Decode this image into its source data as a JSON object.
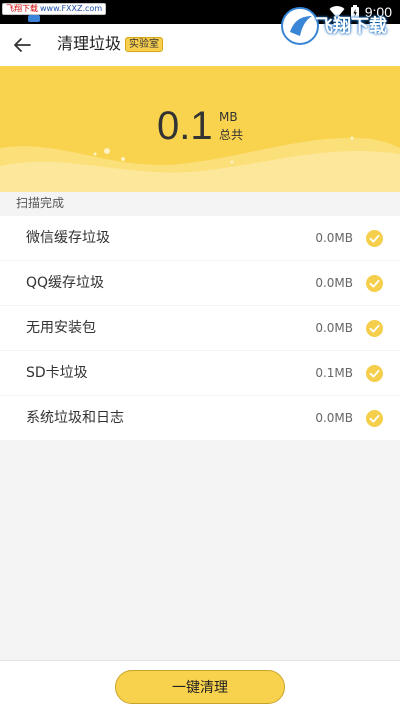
{
  "status_bar": {
    "watermark_text": "飞翔下载",
    "watermark_url": "www.FXXZ.com",
    "time": "9:00"
  },
  "header": {
    "title": "清理垃圾",
    "badge": "实验室"
  },
  "summary": {
    "value": "0.1",
    "unit": "MB",
    "total_label": "总共"
  },
  "section": {
    "label": "扫描完成"
  },
  "items": [
    {
      "label": "微信缓存垃圾",
      "size": "0.0MB"
    },
    {
      "label": "QQ缓存垃圾",
      "size": "0.0MB"
    },
    {
      "label": "无用安装包",
      "size": "0.0MB"
    },
    {
      "label": "SD卡垃圾",
      "size": "0.1MB"
    },
    {
      "label": "系统垃圾和日志",
      "size": "0.0MB"
    }
  ],
  "footer": {
    "button_label": "一键清理",
    "watermark_logo": "飞翔下载"
  },
  "colors": {
    "accent": "#f9d34d",
    "check": "#f5cf4c"
  }
}
